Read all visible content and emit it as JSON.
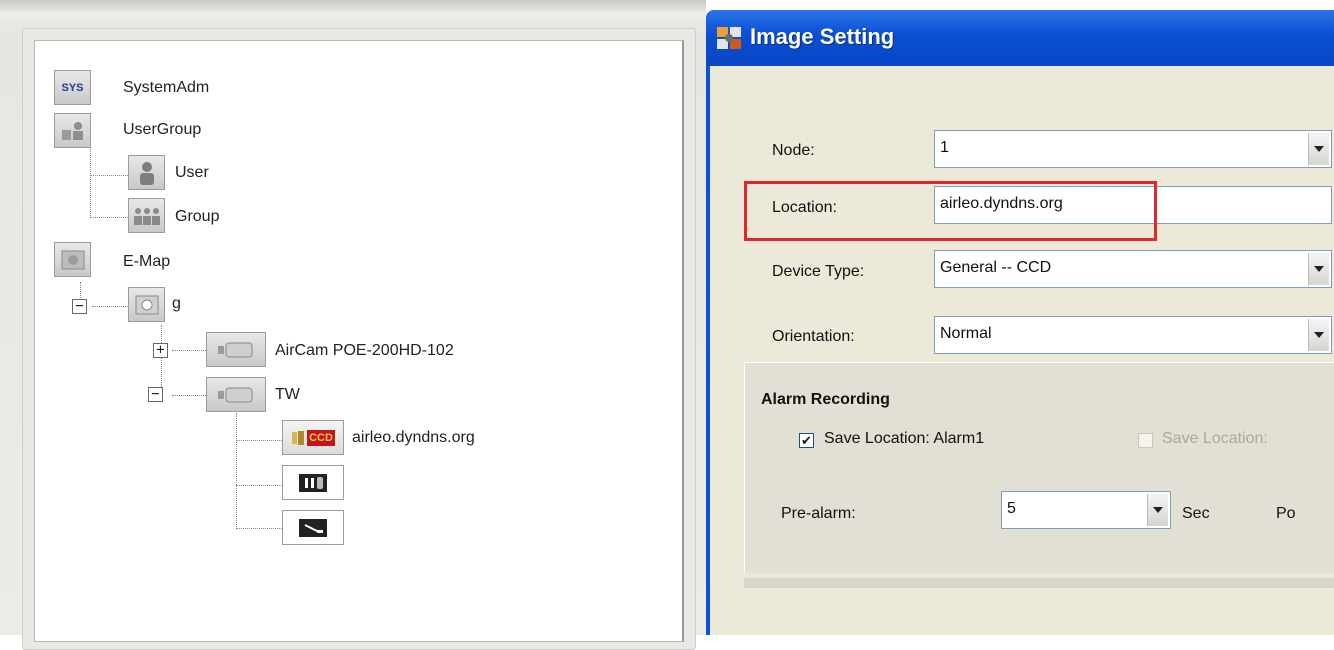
{
  "tree": {
    "nodes": [
      {
        "label": "SystemAdm",
        "icon": "sys-icon",
        "icon_text": "SYS"
      },
      {
        "label": "UserGroup",
        "icon": "user-group-icon"
      },
      {
        "label": "User",
        "icon": "user-icon"
      },
      {
        "label": "Group",
        "icon": "group-icon"
      },
      {
        "label": "E-Map",
        "icon": "emap-icon"
      },
      {
        "label": "g",
        "icon": "map-icon"
      },
      {
        "label": "AirCam POE-200HD-102",
        "icon": "camera-icon"
      },
      {
        "label": "TW",
        "icon": "camera-icon"
      },
      {
        "label": "airleo.dyndns.org",
        "icon": "ccd-camera-icon",
        "icon_text": "CCD"
      },
      {
        "label": "",
        "icon": "io-device-icon"
      },
      {
        "label": "",
        "icon": "switch-icon"
      }
    ],
    "expanders": {
      "g": "−",
      "aircam": "+",
      "tw": "−"
    }
  },
  "dialog": {
    "title": "Image Setting",
    "node": {
      "label": "Node:",
      "value": "1"
    },
    "location": {
      "label": "Location:",
      "value": "airleo.dyndns.org"
    },
    "device_type": {
      "label": "Device Type:",
      "value": "General -- CCD"
    },
    "orientation": {
      "label": "Orientation:",
      "value": "Normal"
    },
    "alarm": {
      "title": "Alarm Recording",
      "save1_label": "Save Location: Alarm1",
      "save1_checked": true,
      "save2_label": "Save Location:",
      "save2_checked": false,
      "pre_alarm_label": "Pre-alarm:",
      "pre_alarm_value": "5",
      "pre_alarm_unit": "Sec",
      "post_label_partial": "Po"
    }
  },
  "colors": {
    "highlight": "#e0272c",
    "titlebar": "#0a4fd2",
    "dialog_bg": "#ece9d8"
  }
}
